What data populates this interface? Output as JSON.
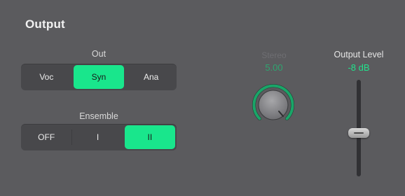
{
  "section": {
    "title": "Output"
  },
  "out": {
    "label": "Out",
    "options": [
      "Voc",
      "Syn",
      "Ana"
    ],
    "selected": "Syn"
  },
  "ensemble": {
    "label": "Ensemble",
    "options": [
      "OFF",
      "I",
      "II"
    ],
    "selected": "II"
  },
  "stereo": {
    "label": "Stereo",
    "value": "5.00",
    "state": "disabled"
  },
  "output_level": {
    "label": "Output Level",
    "value": "-8 dB"
  },
  "colors": {
    "accent": "#19e68c",
    "panel": "#5b5b5e",
    "control_bg": "#48484b"
  }
}
